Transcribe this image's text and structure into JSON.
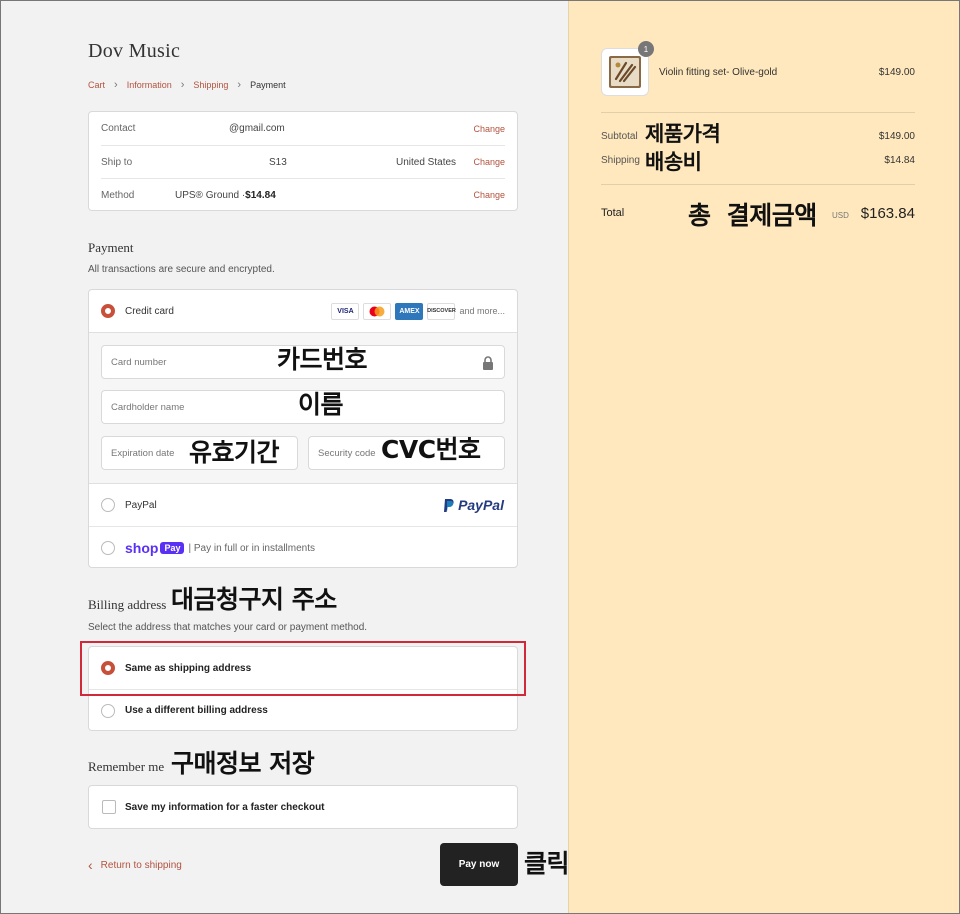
{
  "store": {
    "name": "Dov Music"
  },
  "breadcrumb": {
    "items": [
      "Cart",
      "Information",
      "Shipping"
    ],
    "current": "Payment"
  },
  "review": {
    "contact": {
      "label": "Contact",
      "value": "@gmail.com",
      "change": "Change"
    },
    "ship_to": {
      "label": "Ship to",
      "value": "S13",
      "country": "United States",
      "change": "Change"
    },
    "method": {
      "label": "Method",
      "value": "UPS® Ground · ",
      "price": "$14.84",
      "change": "Change"
    }
  },
  "payment": {
    "title": "Payment",
    "subtitle": "All transactions are secure and encrypted.",
    "credit_card_label": "Credit card",
    "card_brands": [
      "VISA",
      "MC",
      "AMEX",
      "DISCOVER"
    ],
    "more_label": "and more...",
    "fields": {
      "card_number": "Card number",
      "cardholder": "Cardholder name",
      "expiration": "Expiration date",
      "security": "Security code"
    },
    "paypal_label": "PayPal",
    "paypal_logo": "PayPal",
    "shoppay_logo_1": "shop",
    "shoppay_logo_2": "Pay",
    "shoppay_text": "| Pay in full or in installments"
  },
  "billing": {
    "title": "Billing address",
    "subtitle": "Select the address that matches your card or payment method.",
    "same": "Same as shipping address",
    "different": "Use a different billing address"
  },
  "remember": {
    "title": "Remember me",
    "checkbox_label": "Save my information for a faster checkout"
  },
  "actions": {
    "return": "Return to shipping",
    "pay": "Pay now"
  },
  "order": {
    "item_name": "Violin fitting set- Olive-gold",
    "item_qty": "1",
    "item_price": "$149.00",
    "subtotal_label": "Subtotal",
    "subtotal_value": "$149.00",
    "shipping_label": "Shipping",
    "shipping_value": "$14.84",
    "total_label": "Total",
    "currency": "USD",
    "total_value": "$163.84"
  },
  "annotations": {
    "card_number": "카드번호",
    "name": "이름",
    "expiry": "유효기간",
    "cvc": "CVC번호",
    "billing": "대금청구지 주소",
    "remember": "구매정보 저장",
    "click": "클릭",
    "subtotal": "제품가격",
    "shipping": "배송비",
    "total": "총 결제금액"
  },
  "colors": {
    "accent": "#b3533f",
    "radio": "#c8503a",
    "summary_bg": "#ffe8bd",
    "highlight": "#d0293a"
  }
}
